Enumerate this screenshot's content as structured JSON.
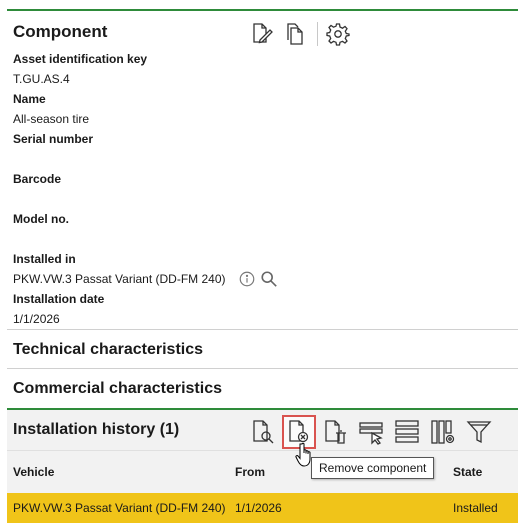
{
  "component": {
    "title": "Component",
    "icons": [
      "edit-document-icon",
      "copy-document-icon",
      "gear-icon"
    ],
    "fields": [
      {
        "label": "Asset identification key",
        "value": "T.GU.AS.4"
      },
      {
        "label": "Name",
        "value": "All-season tire"
      },
      {
        "label": "Serial number",
        "value": ""
      },
      {
        "label": "Barcode",
        "value": ""
      },
      {
        "label": "Model no.",
        "value": ""
      },
      {
        "label": "Installed in",
        "value": "PKW.VW.3 Passat Variant (DD-FM 240)"
      },
      {
        "label": "Installation date",
        "value": "1/1/2026"
      }
    ]
  },
  "technical": {
    "title": "Technical characteristics"
  },
  "commercial": {
    "title": "Commercial characteristics"
  },
  "history": {
    "title": "Installation history (1)",
    "icons": [
      "preview-document-icon",
      "remove-component-icon",
      "delete-document-icon",
      "select-column-icon",
      "rows-icon",
      "column-settings-icon",
      "filter-icon"
    ],
    "columns": [
      "Vehicle",
      "From",
      "",
      "State"
    ],
    "rows": [
      {
        "vehicle": "PKW.VW.3 Passat Variant (DD-FM 240)",
        "from": "1/1/2026",
        "to": "",
        "state": "Installed"
      }
    ]
  },
  "tooltip": "Remove component",
  "colors": {
    "accent_line": "#2e8b3a",
    "selected_row": "#f0c419",
    "highlight_border": "#d9534f"
  }
}
